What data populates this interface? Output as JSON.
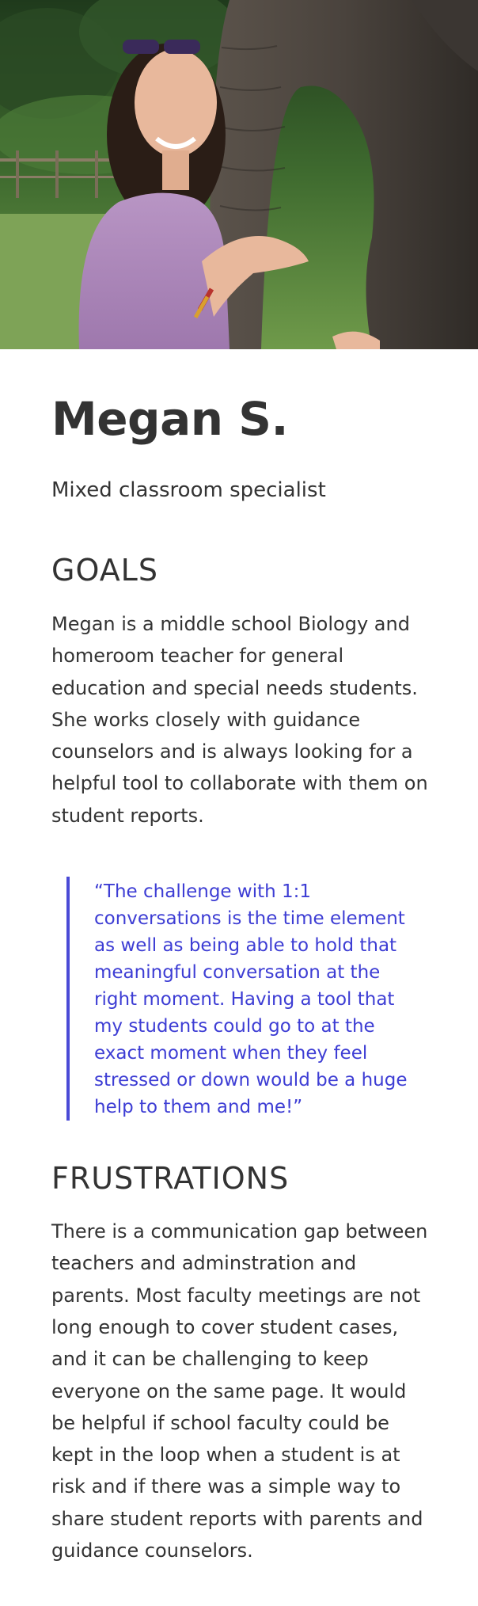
{
  "persona": {
    "name": "Megan S.",
    "role": "Mixed classroom specialist"
  },
  "goals": {
    "title": "GOALS",
    "text": "Megan is a middle school Biology and homeroom teacher for general education and special needs students. She works closely with guidance counselors and is always looking for a helpful tool to collaborate with them on student reports."
  },
  "quote": {
    "text": "“The challenge with 1:1 conversations is the time element as well as being able to hold that meaningful conversation at the right moment. Having a tool that my students could go to at the exact moment when they feel stressed or down would be a huge help to them and me!”"
  },
  "frustrations": {
    "title": "FRUSTRATIONS",
    "text": "There is a communication gap between teachers and adminstration and parents. Most faculty meetings are not long enough to cover student cases, and it can be challenging to keep everyone on the same page. It would be helpful if school faculty could be kept in the loop when a student is at risk and if there was a simple way to share student reports with parents and guidance counselors."
  },
  "colors": {
    "text": "#333333",
    "quote_text": "#3d3dd4",
    "quote_border": "#4a4ad6"
  }
}
